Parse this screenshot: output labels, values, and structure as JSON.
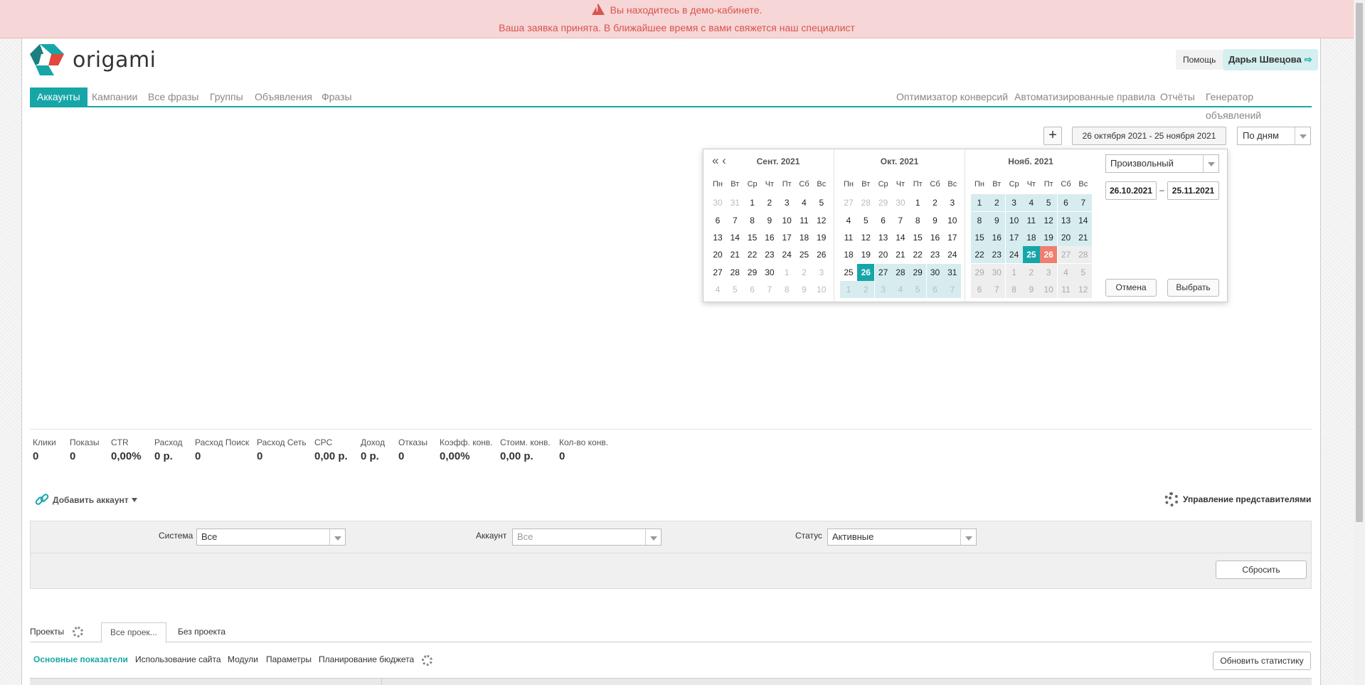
{
  "alert": {
    "line1": "Вы находитесь в демо-кабинете.",
    "line2": "Ваша заявка принята. В ближайшее время с вами свяжется наш специалист"
  },
  "logo": {
    "text": "origami"
  },
  "header": {
    "help": "Помощь",
    "user": "Дарья Швецова"
  },
  "nav": {
    "left": [
      "Аккаунты",
      "Кампании",
      "Все фразы",
      "Группы",
      "Объявления",
      "Фразы"
    ],
    "right": [
      "Оптимизатор конверсий",
      "Автоматизированные правила",
      "Отчёты",
      "Генератор объявлений"
    ]
  },
  "toolbar": {
    "plus": "+",
    "range": "26 октября 2021 - 25 ноября 2021",
    "grouping": "По дням"
  },
  "datepicker": {
    "weekdays": [
      "Пн",
      "Вт",
      "Ср",
      "Чт",
      "Пт",
      "Сб",
      "Вс"
    ],
    "nav": "«  ‹",
    "months": [
      {
        "title": "Сент. 2021",
        "days": [
          30,
          31,
          1,
          2,
          3,
          4,
          5,
          6,
          7,
          8,
          9,
          10,
          11,
          12,
          13,
          14,
          15,
          16,
          17,
          18,
          19,
          20,
          21,
          22,
          23,
          24,
          25,
          26,
          27,
          28,
          29,
          30,
          1,
          2,
          3,
          4,
          5,
          6,
          7,
          8,
          9,
          10
        ],
        "other": [
          0,
          1,
          32,
          33,
          34,
          35,
          36,
          37,
          38,
          39,
          40,
          41
        ]
      },
      {
        "title": "Окт. 2021",
        "days": [
          27,
          28,
          29,
          30,
          1,
          2,
          3,
          4,
          5,
          6,
          7,
          8,
          9,
          10,
          11,
          12,
          13,
          14,
          15,
          16,
          17,
          18,
          19,
          20,
          21,
          22,
          23,
          24,
          25,
          26,
          27,
          28,
          29,
          30,
          31,
          1,
          2,
          3,
          4,
          5,
          6,
          7
        ],
        "other": [
          0,
          1,
          2,
          3,
          35,
          36,
          37,
          38,
          39,
          40,
          41
        ],
        "range": [
          30,
          31,
          32,
          33,
          34,
          35,
          36,
          37,
          38,
          39,
          40,
          41
        ],
        "start": 29
      },
      {
        "title": "Нояб. 2021",
        "days": [
          1,
          2,
          3,
          4,
          5,
          6,
          7,
          8,
          9,
          10,
          11,
          12,
          13,
          14,
          15,
          16,
          17,
          18,
          19,
          20,
          21,
          22,
          23,
          24,
          25,
          26,
          27,
          28,
          29,
          30,
          1,
          2,
          3,
          4,
          5,
          6,
          7,
          8,
          9,
          10,
          11,
          12
        ],
        "range": [
          0,
          1,
          2,
          3,
          4,
          5,
          6,
          7,
          8,
          9,
          10,
          11,
          12,
          13,
          14,
          15,
          16,
          17,
          18,
          19,
          20,
          21,
          22,
          23
        ],
        "today": 24,
        "end": 25,
        "future": [
          26,
          27,
          28,
          29,
          30,
          31,
          32,
          33,
          34,
          35,
          36,
          37,
          38,
          39,
          40,
          41
        ],
        "other": [
          30,
          31,
          32,
          33,
          34,
          35,
          36,
          37,
          38,
          39,
          40,
          41
        ]
      }
    ],
    "preset": "Произвольный",
    "from": "26.10.2021",
    "dash": "–",
    "to": "25.11.2021",
    "cancel": "Отмена",
    "ok": "Выбрать"
  },
  "stats": [
    {
      "label": "Клики",
      "value": "0"
    },
    {
      "label": "Показы",
      "value": "0"
    },
    {
      "label": "CTR",
      "value": "0,00%"
    },
    {
      "label": "Расход",
      "value": "0 р."
    },
    {
      "label": "Расход Поиск",
      "value": "0"
    },
    {
      "label": "Расход Сеть",
      "value": "0"
    },
    {
      "label": "CPC",
      "value": "0,00 р."
    },
    {
      "label": "Доход",
      "value": "0 р."
    },
    {
      "label": "Отказы",
      "value": "0"
    },
    {
      "label": "Коэфф. конв.",
      "value": "0,00%"
    },
    {
      "label": "Стоим. конв.",
      "value": "0,00 р."
    },
    {
      "label": "Кол-во конв.",
      "value": "0"
    }
  ],
  "accounts": {
    "add": "Добавить аккаунт",
    "manage": "Управление представителями"
  },
  "filter": {
    "system_label": "Система",
    "system_value": "Все",
    "account_label": "Аккаунт",
    "account_value": "Все",
    "status_label": "Статус",
    "status_value": "Активные",
    "reset": "Сбросить"
  },
  "projects": {
    "label": "Проекты",
    "tabs": [
      "Все проек...",
      "Без проекта"
    ]
  },
  "subtabs": [
    "Основные показатели",
    "Использование сайта",
    "Модули",
    "Параметры",
    "Планирование бюджета"
  ],
  "refresh": "Обновить статистику",
  "colors": {
    "accent": "#17a6a8",
    "end": "#f07f6f",
    "alert_bg": "#f6d6d6",
    "alert_text": "#d9534f"
  }
}
